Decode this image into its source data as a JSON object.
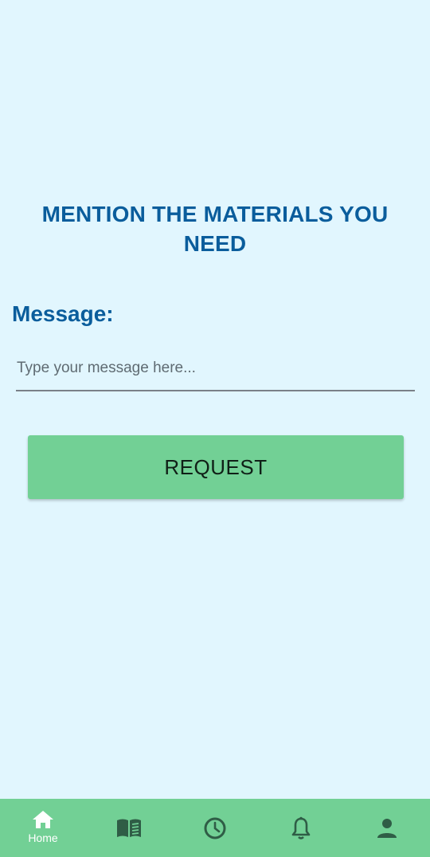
{
  "page": {
    "title_line1": "MENTION THE MATERIALS YOU",
    "title_line2": "NEED"
  },
  "form": {
    "message_label": "Message:",
    "message_value": "",
    "message_placeholder": "Type your message here...",
    "submit_label": "REQUEST"
  },
  "bottom_nav": {
    "items": [
      {
        "icon": "home-icon",
        "label": "Home",
        "active": true
      },
      {
        "icon": "book-icon",
        "label": "",
        "active": false
      },
      {
        "icon": "clock-icon",
        "label": "",
        "active": false
      },
      {
        "icon": "bell-icon",
        "label": "",
        "active": false
      },
      {
        "icon": "person-icon",
        "label": "",
        "active": false
      }
    ]
  },
  "colors": {
    "background": "#e1f6fe",
    "heading": "#0a5d9c",
    "accent_green": "#72d095",
    "icon_dark": "#2f5d46",
    "active_icon": "#ffffff"
  }
}
